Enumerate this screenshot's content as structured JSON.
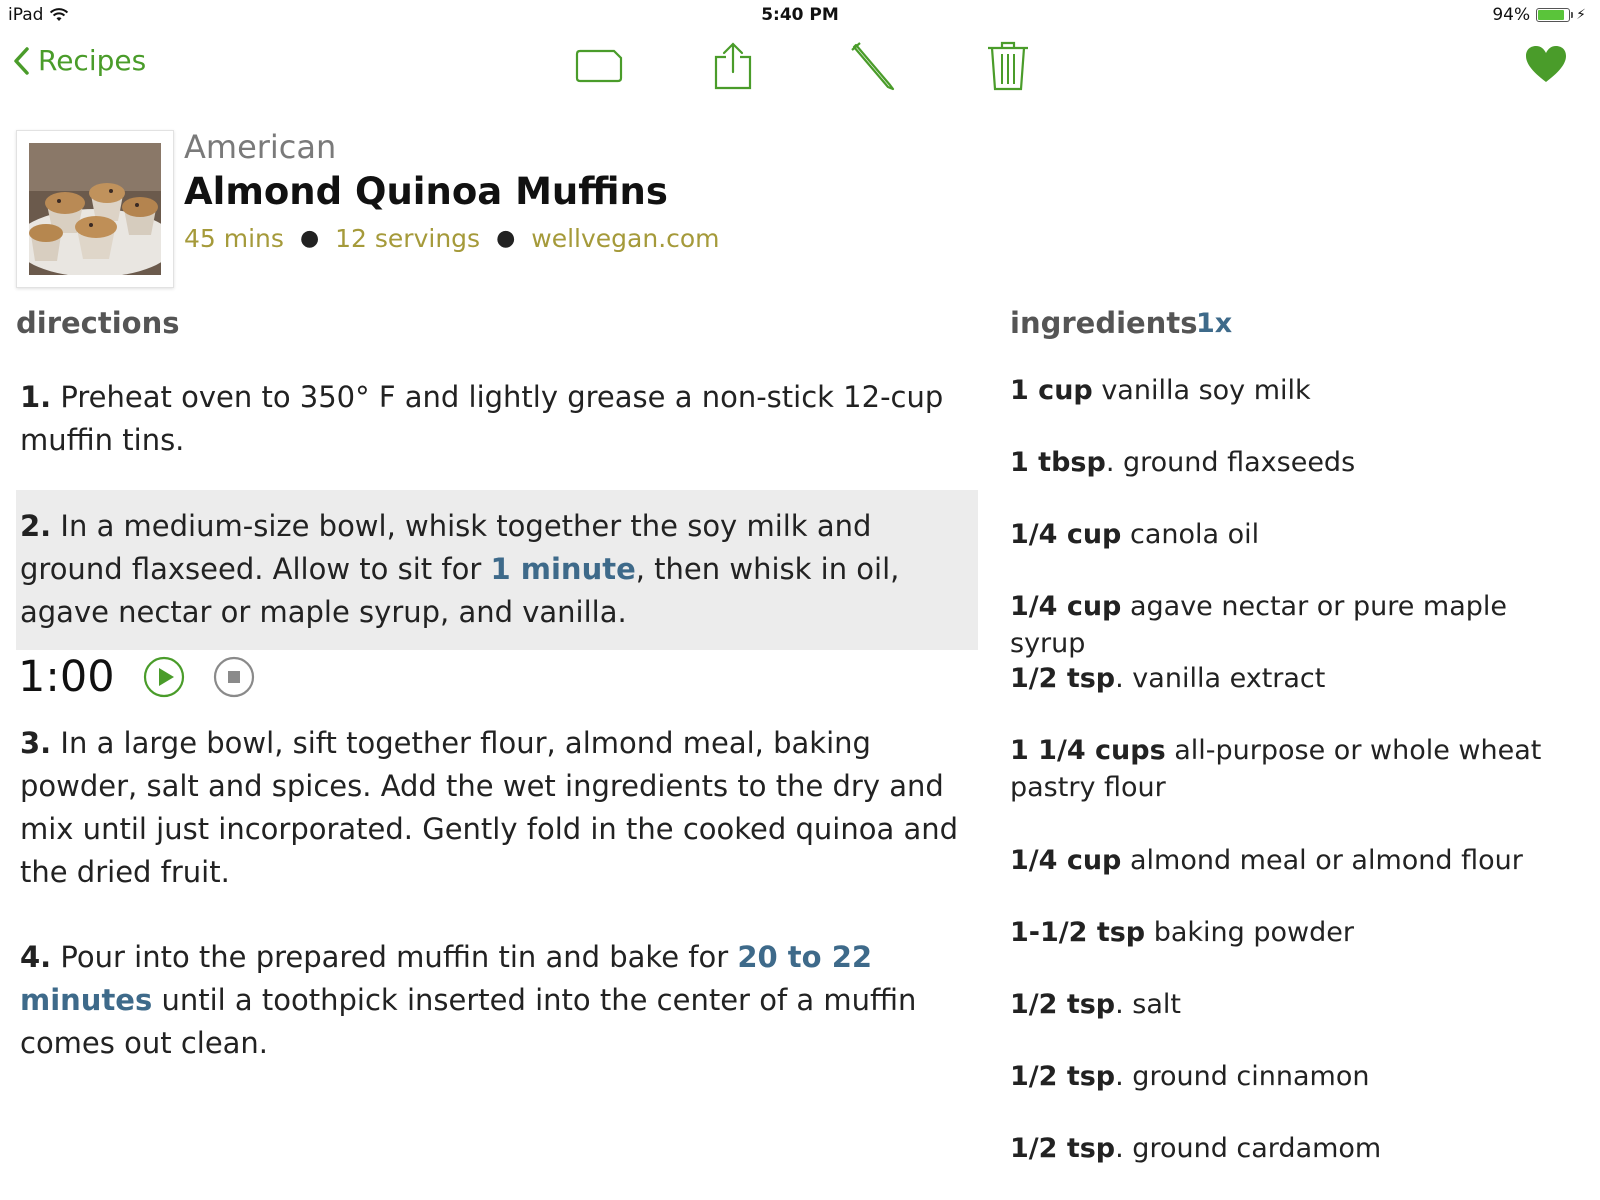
{
  "status_bar": {
    "device": "iPad",
    "time": "5:40 PM",
    "battery_percent": "94%",
    "battery_level": 0.94
  },
  "nav": {
    "back_label": "Recipes",
    "tools": [
      "folder-icon",
      "share-icon",
      "edit-pencil-icon",
      "trash-icon"
    ],
    "favorite_icon": "heart-icon",
    "accent_color": "#4a9c2a"
  },
  "recipe": {
    "cuisine": "American",
    "title": "Almond Quinoa Muffins",
    "time": "45 mins",
    "servings": "12 servings",
    "source": "wellvegan.com",
    "separator": "●"
  },
  "directions": {
    "heading": "directions",
    "steps": [
      {
        "num": "1.",
        "text": " Preheat oven to 350° F and lightly grease a non-stick 12-cup muffin tins."
      },
      {
        "num": "2.",
        "pre": " In a medium-size bowl, whisk together the soy milk and ground flaxseed. Allow to sit for ",
        "highlight": "1 minute",
        "post": ", then whisk in oil, agave nectar or maple syrup, and vanilla."
      },
      {
        "num": "3.",
        "text": " In a large bowl, sift together flour, almond meal, baking powder, salt and spices. Add the wet ingredients to the dry and mix until just incorporated. Gently fold in the cooked quinoa and the dried fruit."
      },
      {
        "num": "4.",
        "pre": " Pour into the prepared muffin tin and bake for ",
        "highlight": "20 to 22 minutes",
        "post": " until a toothpick inserted into the center of a muffin comes out clean."
      }
    ],
    "timer": "1:00"
  },
  "ingredients": {
    "heading": "ingredients",
    "scale": "1x",
    "items": [
      {
        "qty": "1 cup",
        "name": " vanilla soy milk"
      },
      {
        "qty": "1 tbsp",
        "name": ". ground flaxseeds"
      },
      {
        "qty": "1/4 cup",
        "name": " canola oil"
      },
      {
        "qty": "1/4 cup",
        "name": " agave nectar or pure maple syrup"
      },
      {
        "qty": "1/2 tsp",
        "name": ". vanilla extract"
      },
      {
        "qty": "1 1/4 cups",
        "name": " all-purpose or whole wheat pastry flour"
      },
      {
        "qty": "1/4 cup",
        "name": " almond meal or almond flour"
      },
      {
        "qty": "1-1/2 tsp",
        "name": " baking powder"
      },
      {
        "qty": "1/2 tsp",
        "name": ". salt"
      },
      {
        "qty": "1/2 tsp",
        "name": ". ground cinnamon"
      },
      {
        "qty": "1/2 tsp",
        "name": ". ground cardamom"
      }
    ]
  }
}
